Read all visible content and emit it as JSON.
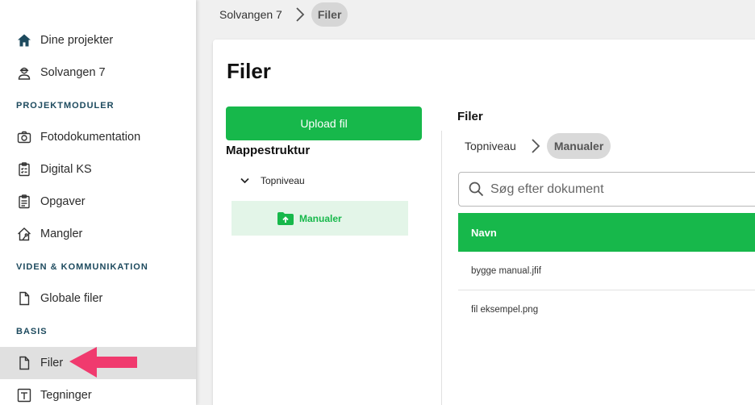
{
  "sidebar": {
    "top_items": [
      {
        "label": "Dine projekter",
        "icon": "home-icon"
      },
      {
        "label": "Solvangen 7",
        "icon": "worker-icon"
      }
    ],
    "sections": [
      {
        "title": "PROJEKTMODULER",
        "items": [
          {
            "label": "Fotodokumentation",
            "icon": "camera-icon"
          },
          {
            "label": "Digital KS",
            "icon": "checklist-icon"
          },
          {
            "label": "Opgaver",
            "icon": "clipboard-icon"
          },
          {
            "label": "Mangler",
            "icon": "house-tool-icon"
          }
        ]
      },
      {
        "title": "VIDEN & KOMMUNIKATION",
        "items": [
          {
            "label": "Globale filer",
            "icon": "file-icon"
          }
        ]
      },
      {
        "title": "BASIS",
        "items": [
          {
            "label": "Filer",
            "icon": "file-icon",
            "active": true
          },
          {
            "label": "Tegninger",
            "icon": "drawing-icon"
          }
        ]
      }
    ]
  },
  "breadcrumb": {
    "parent": "Solvangen 7",
    "current": "Filer"
  },
  "page": {
    "title": "Filer"
  },
  "left_panel": {
    "upload_label": "Upload fil",
    "heading": "Mappestruktur",
    "tree_root": "Topniveau",
    "tree_child": "Manualer"
  },
  "right_panel": {
    "heading": "Filer",
    "crumb_root": "Topniveau",
    "crumb_current": "Manualer",
    "search_placeholder": "Søg efter dokument",
    "column_name": "Navn",
    "files": [
      "bygge manual.jfif",
      "fil eksempel.png"
    ]
  },
  "colors": {
    "accent": "#17b84b",
    "section_title": "#1d4a5e",
    "annotation_arrow": "#f03a6e"
  }
}
